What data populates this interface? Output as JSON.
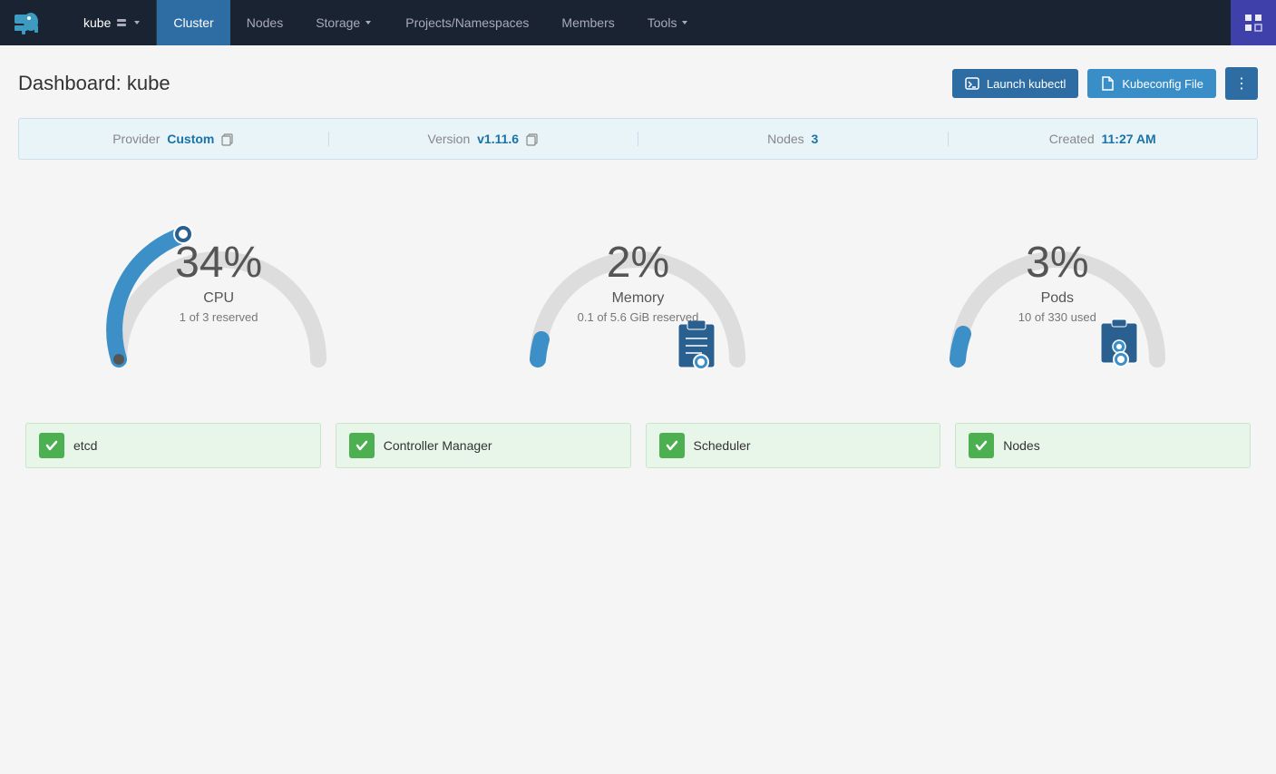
{
  "brand": {
    "alt": "Rancher"
  },
  "nav": {
    "kube_label": "kube",
    "items": [
      {
        "label": "Cluster",
        "active": true
      },
      {
        "label": "Nodes",
        "active": false
      },
      {
        "label": "Storage",
        "active": false,
        "dropdown": true
      },
      {
        "label": "Projects/Namespaces",
        "active": false
      },
      {
        "label": "Members",
        "active": false
      },
      {
        "label": "Tools",
        "active": false,
        "dropdown": true
      }
    ]
  },
  "page": {
    "title": "Dashboard: kube",
    "launch_kubectl_label": "Launch kubectl",
    "kubeconfig_label": "Kubeconfig File",
    "more_icon": "⋮"
  },
  "info_bar": {
    "provider_label": "Provider",
    "provider_value": "Custom",
    "version_label": "Version",
    "version_value": "v1.11.6",
    "nodes_label": "Nodes",
    "nodes_value": "3",
    "created_label": "Created",
    "created_value": "11:27 AM"
  },
  "gauges": [
    {
      "id": "cpu",
      "pct": "34%",
      "label": "CPU",
      "sub": "1 of 3 reserved",
      "fill_color": "#3d8fc8",
      "track_color": "#dde",
      "value": 34
    },
    {
      "id": "memory",
      "pct": "2%",
      "label": "Memory",
      "sub": "0.1 of 5.6 GiB reserved",
      "fill_color": "#3d8fc8",
      "track_color": "#dde",
      "value": 2
    },
    {
      "id": "pods",
      "pct": "3%",
      "label": "Pods",
      "sub": "10 of 330 used",
      "fill_color": "#3d8fc8",
      "track_color": "#dde",
      "value": 3
    }
  ],
  "status_items": [
    {
      "label": "etcd"
    },
    {
      "label": "Controller Manager"
    },
    {
      "label": "Scheduler"
    },
    {
      "label": "Nodes"
    }
  ]
}
